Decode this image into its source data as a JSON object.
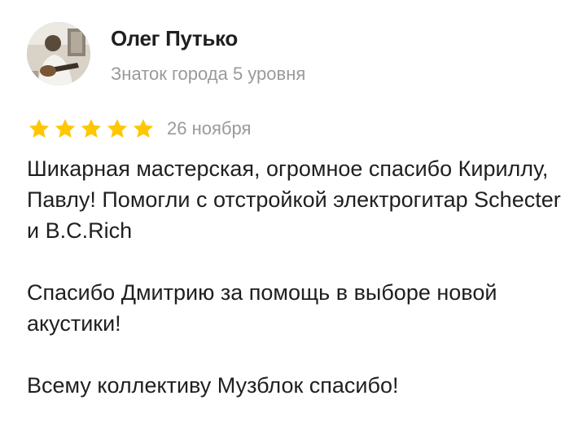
{
  "review": {
    "author": {
      "name": "Олег Путько",
      "level": "Знаток города 5 уровня"
    },
    "rating": {
      "value": 5,
      "max": 5,
      "star_color": "#ffc700"
    },
    "date": "26 ноября",
    "paragraphs": [
      "Шикарная мастерская, огромное спасибо Кириллу, Павлу! Помогли с отстройкой электрогитар Schecter и B.C.Rich",
      "Спасибо Дмитрию за помощь в выборе новой акустики!",
      "Всему коллективу Музблок спасибо!"
    ]
  }
}
